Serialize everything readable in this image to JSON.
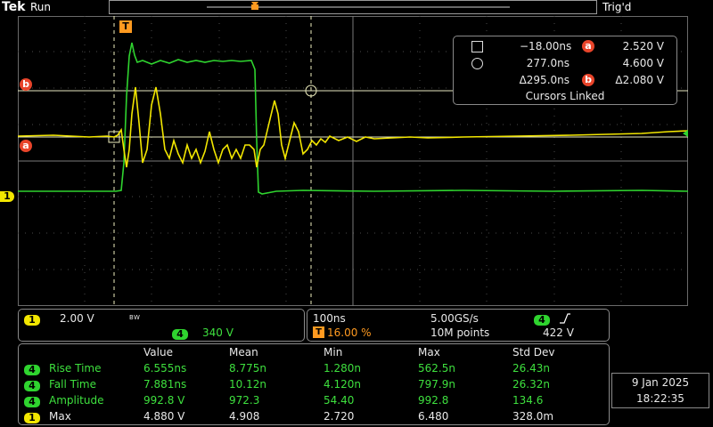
{
  "header": {
    "brand": "Tek",
    "run_state": "Run",
    "trigger_state": "Trig'd"
  },
  "markers": {
    "trigger_marker": "T",
    "ref_a": "a",
    "ref_b": "b",
    "ch1_marker": "1"
  },
  "cursor_readout": {
    "row1_time": "−18.00ns",
    "row1_volt": "2.520 V",
    "row2_time": "277.0ns",
    "row2_volt": "4.600 V",
    "delta_time": "Δ295.0ns",
    "delta_volt": "Δ2.080 V",
    "linked": "Cursors Linked"
  },
  "channels": {
    "ch1_label": "1",
    "ch1_scale": "2.00 V",
    "bw_label": "B W",
    "ch4_label": "4",
    "ch4_scale": "340 V"
  },
  "timebase": {
    "horizontal_scale": "100ns",
    "sample_rate": "5.00GS/s",
    "trigger_source": "4",
    "trigger_position_label": "T",
    "trigger_position": "16.00 %",
    "record_length": "10M points",
    "trigger_level": "422 V"
  },
  "measurements": {
    "headers": [
      "Value",
      "Mean",
      "Min",
      "Max",
      "Std Dev"
    ],
    "rows": [
      {
        "channel": "4",
        "name": "Rise Time",
        "value": "6.555ns",
        "mean": "8.775n",
        "min": "1.280n",
        "max": "562.5n",
        "std": "26.43n"
      },
      {
        "channel": "4",
        "name": "Fall Time",
        "value": "7.881ns",
        "mean": "10.12n",
        "min": "4.120n",
        "max": "797.9n",
        "std": "26.32n"
      },
      {
        "channel": "4",
        "name": "Amplitude",
        "value": "992.8 V",
        "mean": "972.3",
        "min": "54.40",
        "max": "992.8",
        "std": "134.6"
      },
      {
        "channel": "1",
        "name": "Max",
        "value": "4.880 V",
        "mean": "4.908",
        "min": "2.720",
        "max": "6.480",
        "std": "328.0m"
      }
    ]
  },
  "datetime": {
    "date": "9 Jan  2025",
    "time": "18:22:35"
  },
  "colors": {
    "ch1": "#f2e600",
    "ch4": "#2fd42f",
    "ref": "#e8442a",
    "trigger": "#ff9a20"
  }
}
